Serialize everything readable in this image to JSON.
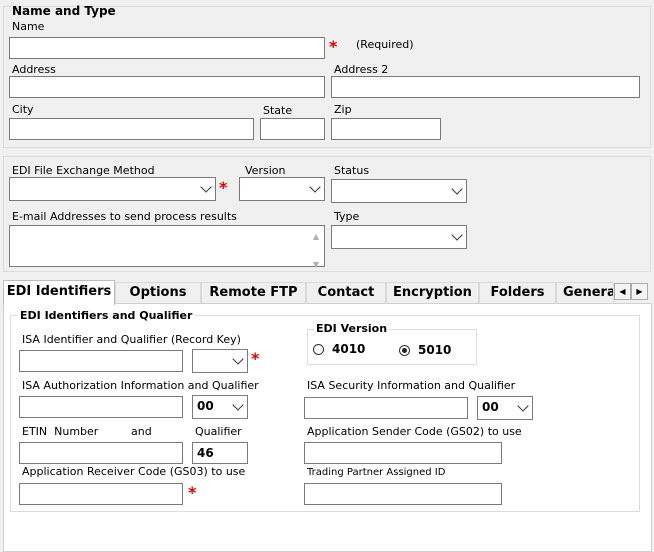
{
  "name_type": {
    "title": "Name and Type",
    "name_label": "Name",
    "name_value": "",
    "required_note": "(Required)",
    "address_label": "Address",
    "address_value": "",
    "address2_label": "Address 2",
    "address2_value": "",
    "city_label": "City",
    "city_value": "",
    "state_label": "State",
    "state_value": "",
    "zip_label": "Zip",
    "zip_value": ""
  },
  "exchange": {
    "method_label": "EDI File Exchange Method",
    "method_value": "",
    "version_label": "Version",
    "version_value": "",
    "status_label": "Status",
    "status_value": "",
    "email_label": "E-mail Addresses to send process results",
    "email_value": "",
    "type_label": "Type",
    "type_value": ""
  },
  "tabs": [
    {
      "label": "EDI Identifiers",
      "active": true
    },
    {
      "label": "Options"
    },
    {
      "label": "Remote FTP"
    },
    {
      "label": "Contact"
    },
    {
      "label": "Encryption"
    },
    {
      "label": "Folders"
    },
    {
      "label": "Genera"
    }
  ],
  "edi": {
    "group_title": "EDI Identifiers and Qualifier",
    "isa_id_label": "ISA Identifier and Qualifier (Record Key)",
    "isa_id_value": "",
    "isa_id_qual_value": "",
    "edi_version_title": "EDI Version",
    "version_4010": "4010",
    "version_5010": "5010",
    "selected_version": "5010",
    "isa_auth_label": "ISA Authorization Information and Qualifier",
    "isa_auth_value": "",
    "isa_auth_qual_value": "00",
    "isa_sec_label": "ISA Security Information and Qualifier",
    "isa_sec_value": "",
    "isa_sec_qual_value": "00",
    "etin_label_1": "ETIN  Number",
    "etin_label_2": "and",
    "qualifier_label": "Qualifier",
    "etin_value": "",
    "qualifier_value": "46",
    "gs02_label": "Application Sender Code (GS02) to use",
    "gs02_value": "",
    "gs03_label": "Application Receiver Code (GS03) to use",
    "gs03_value": "",
    "tp_id_label": "Trading Partner Assigned ID",
    "tp_id_value": ""
  },
  "colors": {
    "required": "#e00000",
    "panel_bg": "#f0f0f0",
    "tab_bg": "#ffffff"
  }
}
